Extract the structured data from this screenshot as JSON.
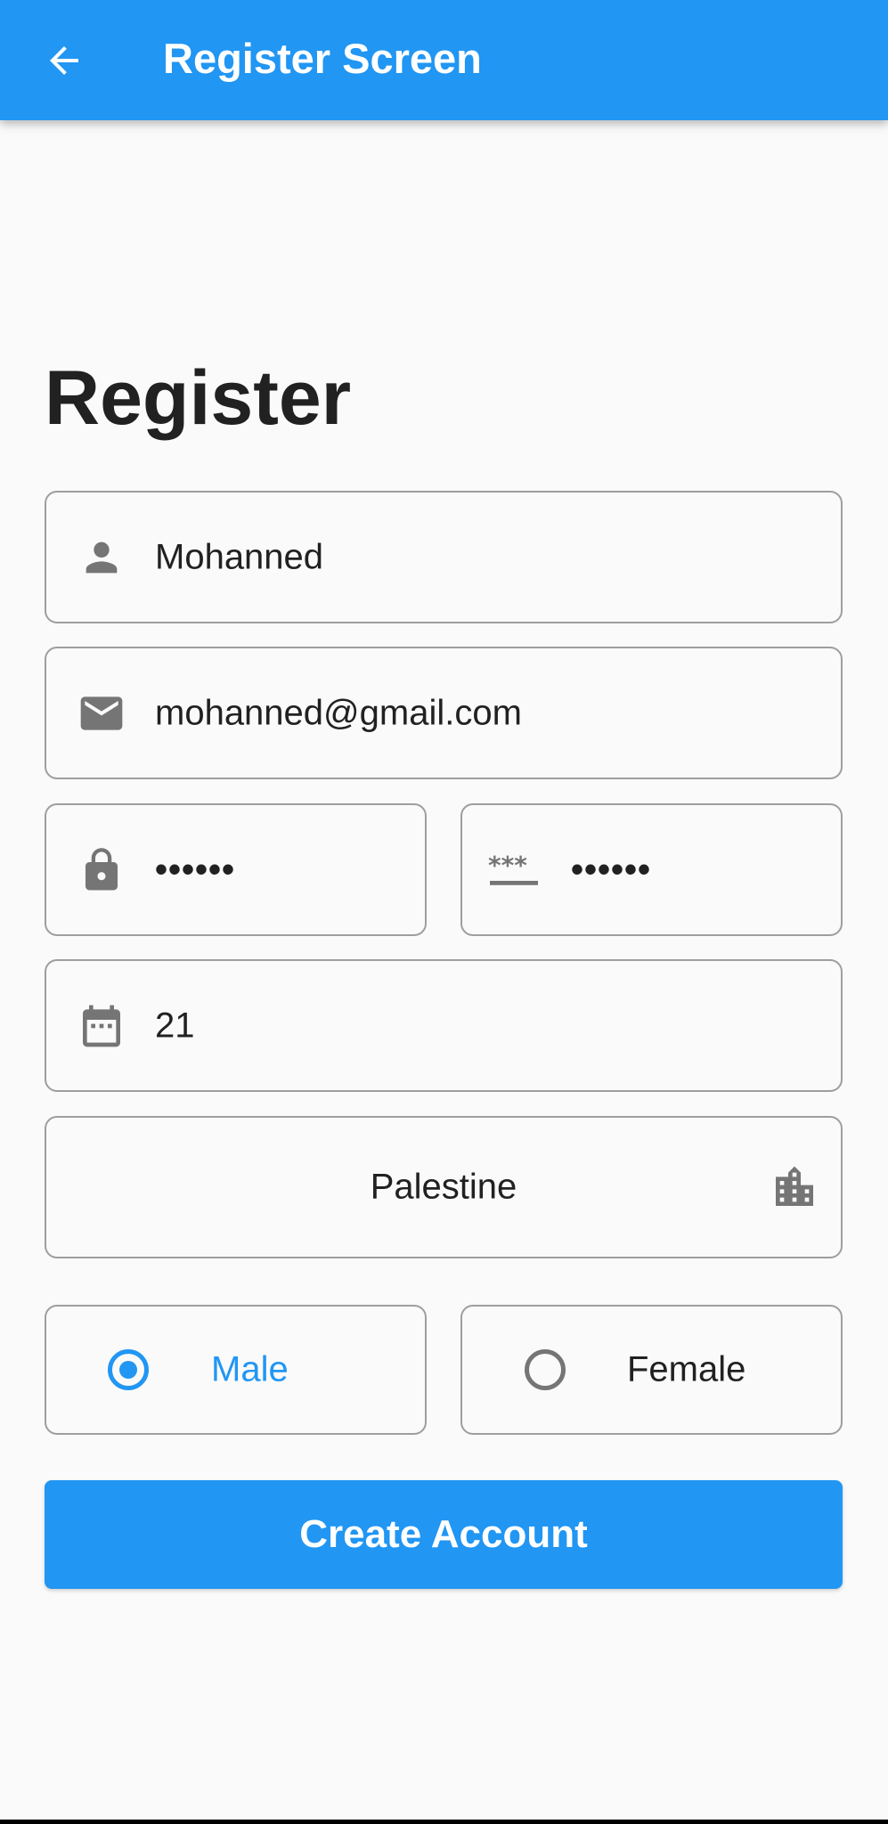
{
  "appbar": {
    "title": "Register Screen",
    "back_icon": "arrow-back-icon",
    "color": "#2196f3"
  },
  "heading": "Register",
  "form": {
    "name": {
      "value": "Mohanned",
      "icon": "person-icon"
    },
    "email": {
      "value": "mohanned@gmail.com",
      "icon": "mail-icon"
    },
    "password": {
      "value": "••••••",
      "icon": "lock-icon"
    },
    "confirm_password": {
      "value": "••••••",
      "icon": "password-icon"
    },
    "age": {
      "value": "21",
      "icon": "calendar-icon"
    },
    "country": {
      "value": "Palestine",
      "icon": "city-icon"
    },
    "gender": {
      "options": [
        {
          "label": "Male",
          "selected": true
        },
        {
          "label": "Female",
          "selected": false
        }
      ]
    }
  },
  "submit": {
    "label": "Create Account"
  },
  "colors": {
    "accent": "#2196f3",
    "icon": "#757575",
    "border": "#9e9e9e"
  }
}
